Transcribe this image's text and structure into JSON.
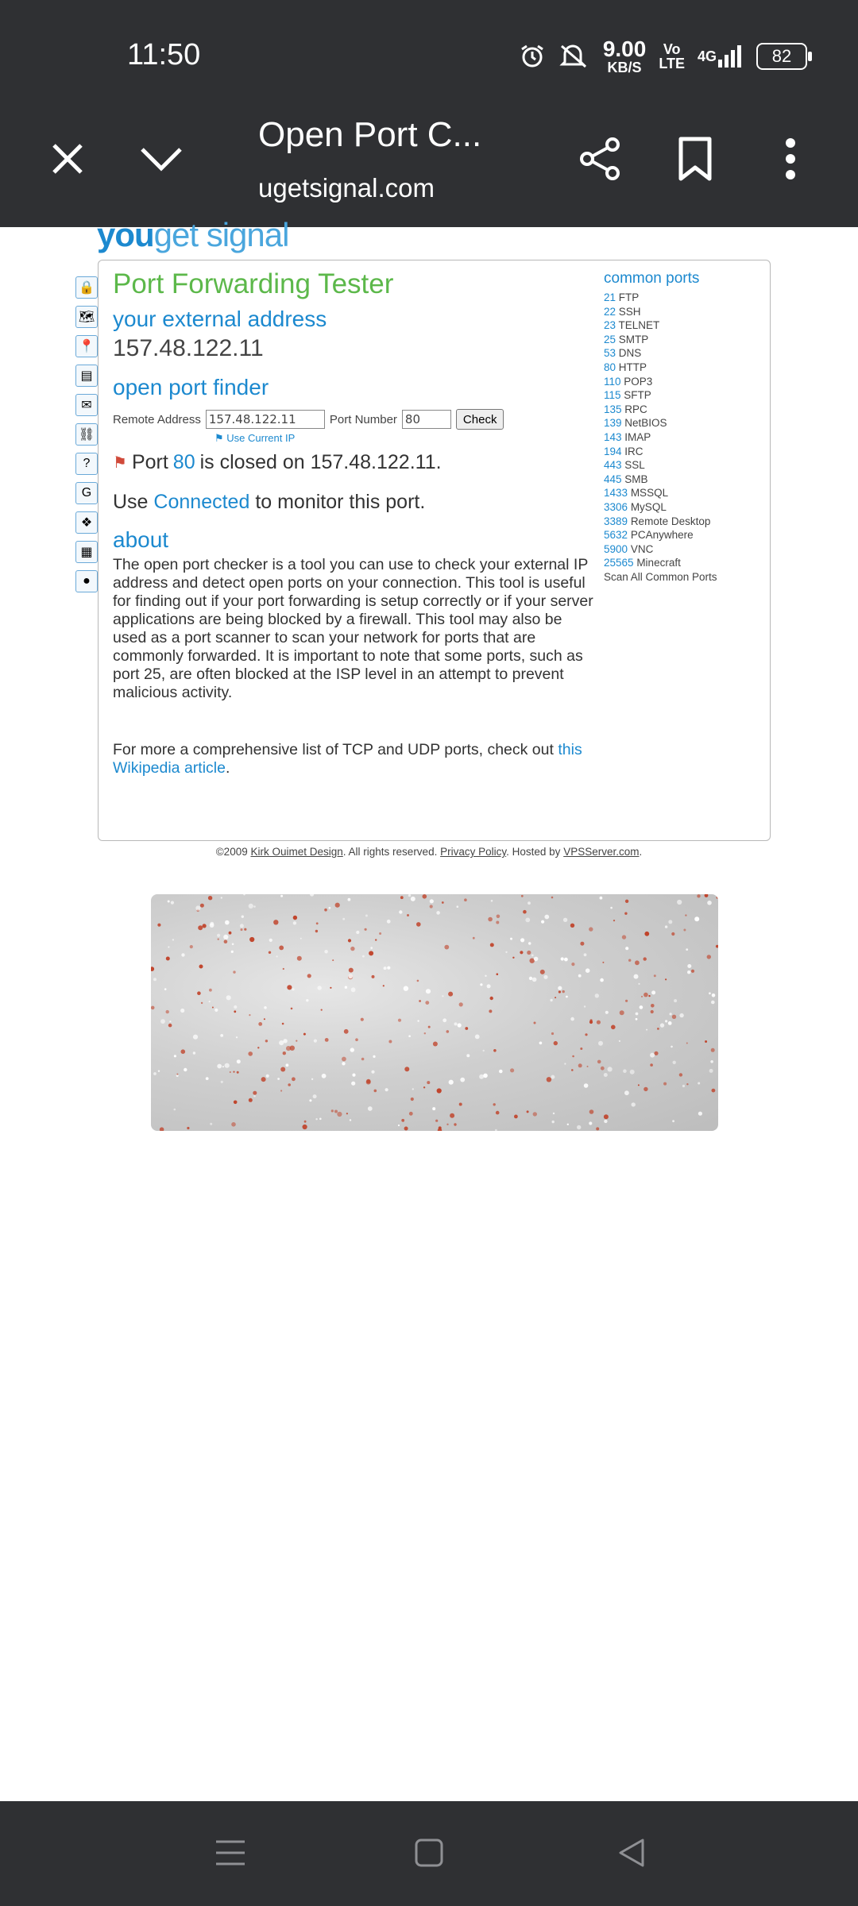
{
  "status_bar": {
    "time": "11:50",
    "net_speed_value": "9.00",
    "net_speed_unit": "KB/S",
    "volte_top": "Vo",
    "volte_bottom": "LTE",
    "network": "4G",
    "battery": "82",
    "icons": [
      "alarm-icon",
      "mute-icon",
      "signal-icon",
      "battery-icon"
    ]
  },
  "browser": {
    "tab_title": "Open Port C...",
    "url": "ugetsignal.com",
    "icons": [
      "close-icon",
      "chevron-down-icon",
      "share-icon",
      "bookmark-icon",
      "more-vert-icon"
    ]
  },
  "site": {
    "logo_bold": "you",
    "logo_light": "get signal",
    "title": "Port Forwarding Tester",
    "external_heading": "your external address",
    "external_ip": "157.48.122.11",
    "finder_heading": "open port finder",
    "remote_label": "Remote Address",
    "remote_value": "157.48.122.11",
    "port_label": "Port Number",
    "port_value": "80",
    "check_label": "Check",
    "use_current_ip": "Use Current IP",
    "result_prefix": "Port",
    "result_port": "80",
    "result_suffix": "is closed on 157.48.122.11.",
    "monitor_prefix": "Use",
    "monitor_link": "Connected",
    "monitor_suffix": "to monitor this port.",
    "about_heading": "about",
    "about_text": "The open port checker is a tool you can use to check your external IP address and detect open ports on your connection. This tool is useful for finding out if your port forwarding is setup correctly or if your server applications are being blocked by a firewall. This tool may also be used as a port scanner to scan your network for ports that are commonly forwarded. It is important to note that some ports, such as port 25, are often blocked at the ISP level in an attempt to prevent malicious activity.",
    "more_text_prefix": "For more a comprehensive list of TCP and UDP ports, check out",
    "more_text_link": "this Wikipedia article",
    "more_text_suffix": ".",
    "common_ports_heading": "common ports",
    "common_ports": [
      {
        "port": "21",
        "name": "FTP"
      },
      {
        "port": "22",
        "name": "SSH"
      },
      {
        "port": "23",
        "name": "TELNET"
      },
      {
        "port": "25",
        "name": "SMTP"
      },
      {
        "port": "53",
        "name": "DNS"
      },
      {
        "port": "80",
        "name": "HTTP"
      },
      {
        "port": "110",
        "name": "POP3"
      },
      {
        "port": "115",
        "name": "SFTP"
      },
      {
        "port": "135",
        "name": "RPC"
      },
      {
        "port": "139",
        "name": "NetBIOS"
      },
      {
        "port": "143",
        "name": "IMAP"
      },
      {
        "port": "194",
        "name": "IRC"
      },
      {
        "port": "443",
        "name": "SSL"
      },
      {
        "port": "445",
        "name": "SMB"
      },
      {
        "port": "1433",
        "name": "MSSQL"
      },
      {
        "port": "3306",
        "name": "MySQL"
      },
      {
        "port": "3389",
        "name": "Remote Desktop"
      },
      {
        "port": "5632",
        "name": "PCAnywhere"
      },
      {
        "port": "5900",
        "name": "VNC"
      },
      {
        "port": "25565",
        "name": "Minecraft"
      }
    ],
    "scan_all": "Scan All Common Ports",
    "footer": {
      "copyright": "©2009",
      "author": "Kirk Ouimet Design",
      "rights": ". All rights reserved.",
      "privacy": "Privacy Policy",
      "hosted": ". Hosted by",
      "host": "VPSServer.com",
      "end": "."
    }
  },
  "nav_bar": {
    "icons": [
      "menu-icon",
      "home-square-icon",
      "back-triangle-icon"
    ]
  }
}
